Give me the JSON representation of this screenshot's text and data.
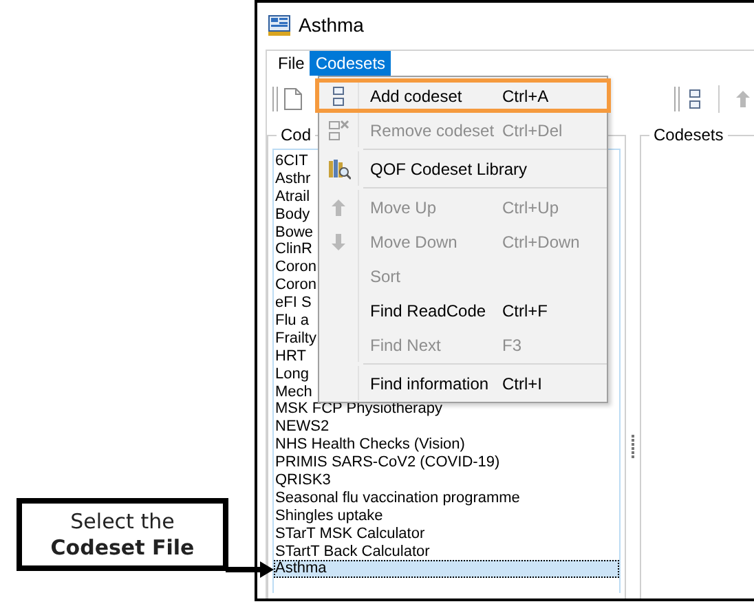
{
  "window": {
    "title": "Asthma"
  },
  "menu_bar": [
    {
      "label": "File",
      "selected": false
    },
    {
      "label": "Codesets",
      "selected": true
    }
  ],
  "codesets_menu": {
    "items": [
      {
        "kind": "item",
        "label": "Add codeset",
        "shortcut": "Ctrl+A",
        "disabled": false,
        "highlighted": true
      },
      {
        "kind": "item",
        "label": "Remove codeset",
        "shortcut": "Ctrl+Del",
        "disabled": true,
        "highlighted": false
      },
      {
        "kind": "separator"
      },
      {
        "kind": "item",
        "label": "QOF Codeset Library",
        "disabled": false,
        "highlighted": false
      },
      {
        "kind": "separator"
      },
      {
        "kind": "item",
        "label": "Move Up",
        "shortcut": "Ctrl+Up",
        "disabled": true,
        "highlighted": false
      },
      {
        "kind": "item",
        "label": "Move Down",
        "shortcut": "Ctrl+Down",
        "disabled": true,
        "highlighted": false
      },
      {
        "kind": "item",
        "label": "Sort",
        "disabled": true,
        "highlighted": false
      },
      {
        "kind": "item",
        "label": "Find ReadCode",
        "shortcut": "Ctrl+F",
        "disabled": false,
        "highlighted": false
      },
      {
        "kind": "item",
        "label": "Find Next",
        "shortcut": "F3",
        "disabled": true,
        "highlighted": false
      },
      {
        "kind": "separator"
      },
      {
        "kind": "item",
        "label": "Find information",
        "shortcut": "Ctrl+I",
        "disabled": false,
        "highlighted": false
      }
    ]
  },
  "left_group": {
    "title": "Cod",
    "list": [
      {
        "text": "6CIT",
        "selected": false
      },
      {
        "text": "Asthr",
        "selected": false
      },
      {
        "text": "Atrail",
        "selected": false
      },
      {
        "text": "Body",
        "selected": false
      },
      {
        "text": "Bowe",
        "selected": false
      },
      {
        "text": "ClinR",
        "selected": false
      },
      {
        "text": "Coron",
        "selected": false
      },
      {
        "text": "Coron",
        "selected": false
      },
      {
        "text": "eFI S",
        "selected": false
      },
      {
        "text": "Flu a",
        "selected": false
      },
      {
        "text": "Frailty",
        "selected": false
      },
      {
        "text": "HRT",
        "selected": false
      },
      {
        "text": "Long",
        "selected": false
      },
      {
        "text": "Mech",
        "selected": false
      },
      {
        "text": "MSK FCP Physiotherapy",
        "selected": false
      },
      {
        "text": "NEWS2",
        "selected": false
      },
      {
        "text": "NHS Health Checks (Vision)",
        "selected": false
      },
      {
        "text": "PRIMIS SARS-CoV2 (COVID-19)",
        "selected": false
      },
      {
        "text": "QRISK3",
        "selected": false
      },
      {
        "text": "Seasonal flu vaccination programme",
        "selected": false
      },
      {
        "text": "Shingles uptake",
        "selected": false
      },
      {
        "text": "STarT MSK Calculator",
        "selected": false
      },
      {
        "text": "STartT Back Calculator",
        "selected": false
      },
      {
        "text": "Asthma",
        "selected": true
      }
    ]
  },
  "right_group": {
    "title": "Codesets"
  },
  "callout": {
    "text": "Select the **Codeset File**"
  }
}
